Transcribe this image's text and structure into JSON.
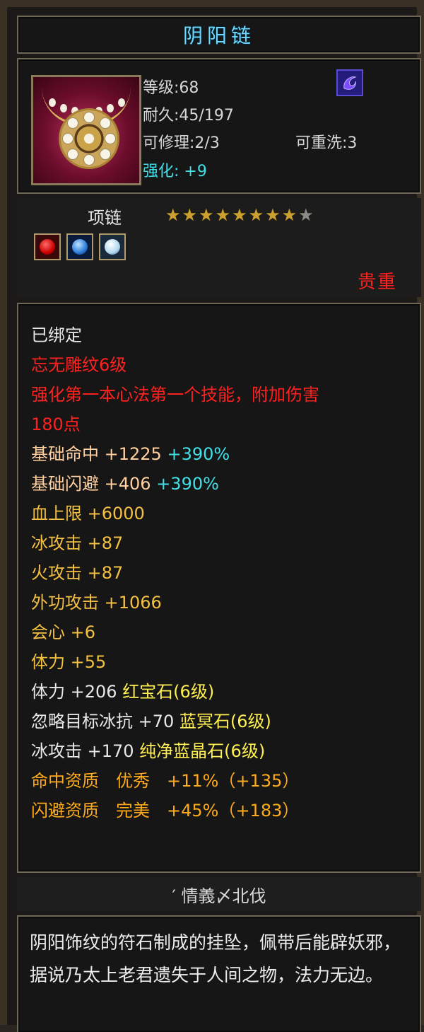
{
  "item": {
    "name": "阴阳链",
    "level": "等级:68",
    "durability": "耐久:45/197",
    "repairable": "可修理:2/3",
    "rewashable": "可重洗:3",
    "enhance_label": "强化:",
    "enhance_value": "+9",
    "type": "项链",
    "stars_filled": 8,
    "stars_total": 9,
    "rarity": "贵重"
  },
  "sockets": [
    {
      "icon": "red-gem-icon",
      "color": "#d01818"
    },
    {
      "icon": "blue-gem-icon",
      "color": "#2a7ad8"
    },
    {
      "icon": "crystal-gem-icon",
      "color": "#b0d8f0"
    }
  ],
  "attributes": {
    "bound": "已绑定",
    "engrave": "忘无雕纹6级",
    "skill_line1": "强化第一本心法第一个技能，附加伤害",
    "skill_line2": "180点",
    "base_hit_label": "基础命中 +1225",
    "base_hit_bonus": "+390%",
    "base_dodge_label": "基础闪避 +406",
    "base_dodge_bonus": "+390%",
    "hp": "血上限 +6000",
    "ice_attack": "冰攻击 +87",
    "fire_attack": "火攻击 +87",
    "outer_attack": "外功攻击 +1066",
    "crit": "会心 +6",
    "stamina": "体力 +55",
    "gem1_stat": "体力 +206",
    "gem1_name": "红宝石(6级)",
    "gem2_stat": "忽略目标冰抗 +70",
    "gem2_name": "蓝冥石(6级)",
    "gem3_stat": "冰攻击 +170",
    "gem3_name": "纯净蓝晶石(6级)",
    "hit_quality": "命中资质　优秀　+11%（+135）",
    "dodge_quality": "闪避资质　完美　+45%（+183）"
  },
  "source": "′ 情義〆北伐",
  "description": "阴阳饰纹的符石制成的挂坠，佩带后能辟妖邪，据说乃太上老君遗失于人间之物，法力无边。",
  "colors": {
    "title": "#6fd8ff",
    "rarity": "#ff2020",
    "enhance": "#41e0e8",
    "star": "#caa030"
  }
}
